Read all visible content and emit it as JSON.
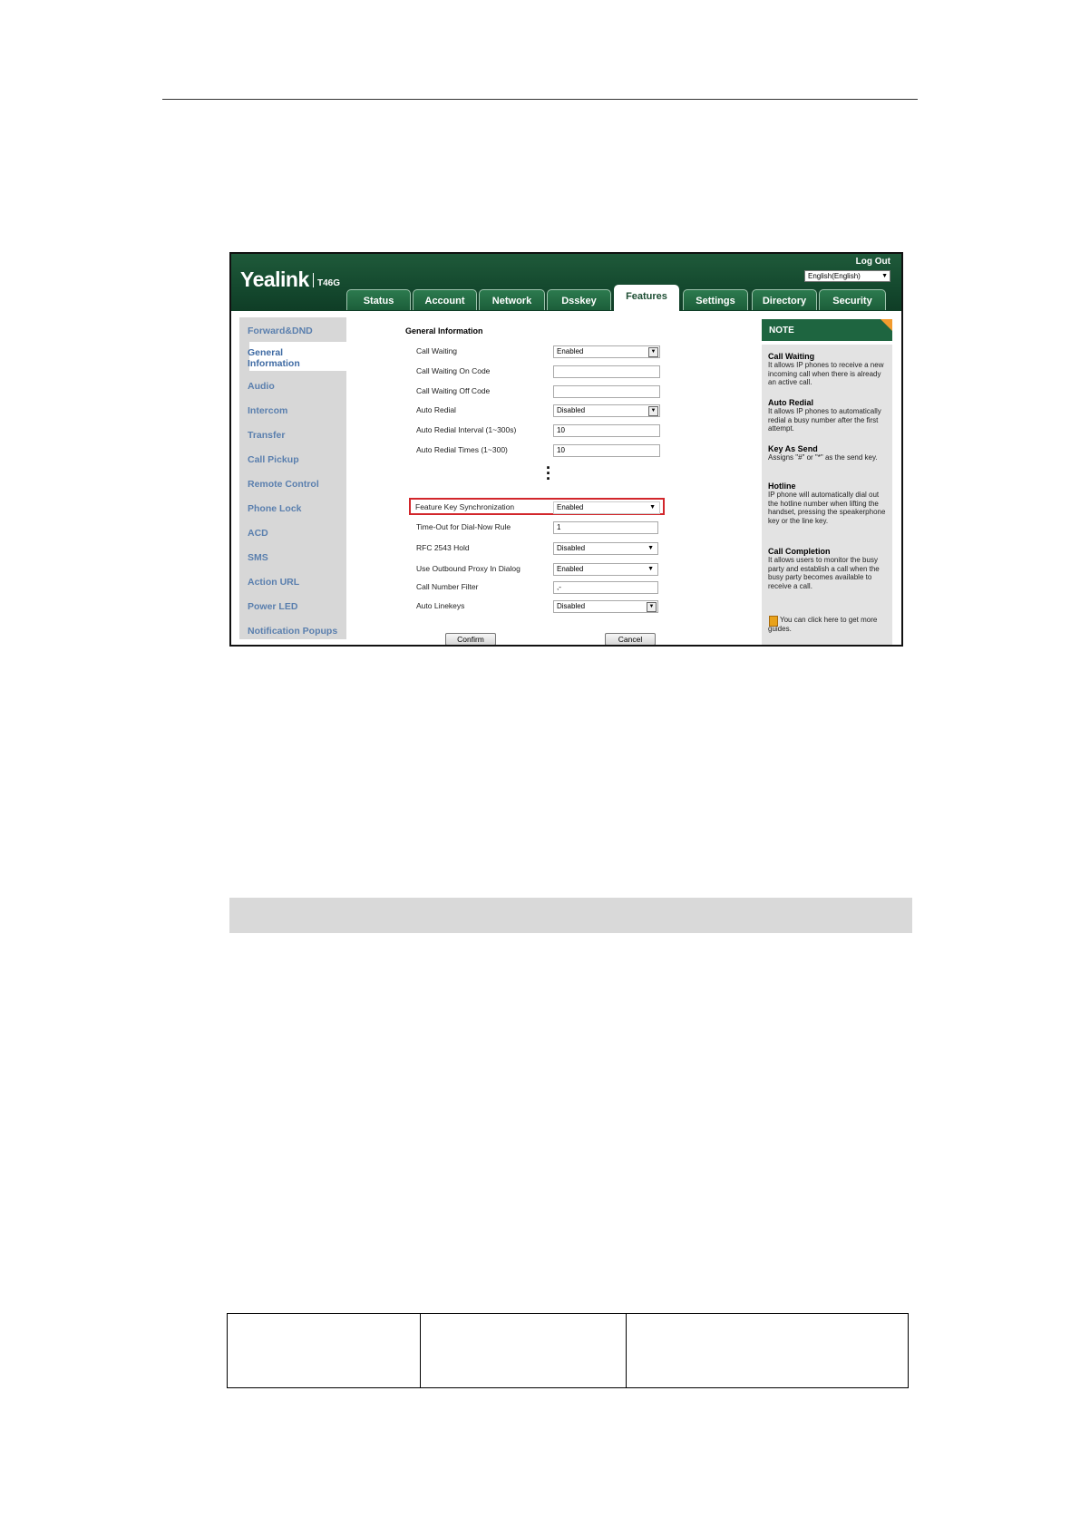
{
  "app": {
    "brand": "Yealink",
    "model": "T46G",
    "logout": "Log Out",
    "language": "English(English)"
  },
  "tabs": [
    {
      "label": "Status",
      "active": false
    },
    {
      "label": "Account",
      "active": false
    },
    {
      "label": "Network",
      "active": false
    },
    {
      "label": "Dsskey",
      "active": false
    },
    {
      "label": "Features",
      "active": true
    },
    {
      "label": "Settings",
      "active": false
    },
    {
      "label": "Directory",
      "active": false
    },
    {
      "label": "Security",
      "active": false
    }
  ],
  "sidebar": {
    "items": [
      {
        "label": "Forward&DND"
      },
      {
        "label": "General Information",
        "active": true
      },
      {
        "label": "Audio"
      },
      {
        "label": "Intercom"
      },
      {
        "label": "Transfer"
      },
      {
        "label": "Call Pickup"
      },
      {
        "label": "Remote Control"
      },
      {
        "label": "Phone Lock"
      },
      {
        "label": "ACD"
      },
      {
        "label": "SMS"
      },
      {
        "label": "Action URL"
      },
      {
        "label": "Power LED"
      },
      {
        "label": "Notification Popups"
      }
    ]
  },
  "form": {
    "section_title": "General Information",
    "fields": [
      {
        "label": "Call Waiting",
        "value": "Enabled"
      },
      {
        "label": "Call Waiting On Code",
        "value": ""
      },
      {
        "label": "Call Waiting Off Code",
        "value": ""
      },
      {
        "label": "Auto Redial",
        "value": "Disabled"
      },
      {
        "label": "Auto Redial Interval (1~300s)",
        "value": "10"
      },
      {
        "label": "Auto Redial Times (1~300)",
        "value": "10"
      },
      {
        "label": "Feature Key Synchronization",
        "value": "Enabled"
      },
      {
        "label": "Time-Out for Dial-Now Rule",
        "value": "1"
      },
      {
        "label": "RFC 2543 Hold",
        "value": "Disabled"
      },
      {
        "label": "Use Outbound Proxy In Dialog",
        "value": "Enabled"
      },
      {
        "label": "Call Number Filter",
        "value": ",-"
      },
      {
        "label": "Auto Linekeys",
        "value": "Disabled"
      }
    ],
    "confirm": "Confirm",
    "cancel": "Cancel"
  },
  "note": {
    "title": "NOTE",
    "entries": [
      {
        "title": "Call Waiting",
        "text": "It allows IP phones to receive a new incoming call when there is already an active call."
      },
      {
        "title": "Auto Redial",
        "text": "It allows IP phones to automatically redial a busy number after the first attempt."
      },
      {
        "title": "Key As Send",
        "text": "Assigns \"#\" or \"*\" as the send key."
      },
      {
        "title": "Hotline",
        "text": "IP phone will automatically dial out the hotline number when lifting the handset, pressing the speakerphone key or the line key."
      },
      {
        "title": "Call Completion",
        "text": "It allows users to monitor the busy party and establish a call when the busy party becomes available to receive a call."
      }
    ],
    "guide": "You can click here to get more guides."
  },
  "colors": {
    "header_green": "#1f5a3a",
    "highlight_red": "#d2262b",
    "sidebar_link": "#5a7fae"
  }
}
